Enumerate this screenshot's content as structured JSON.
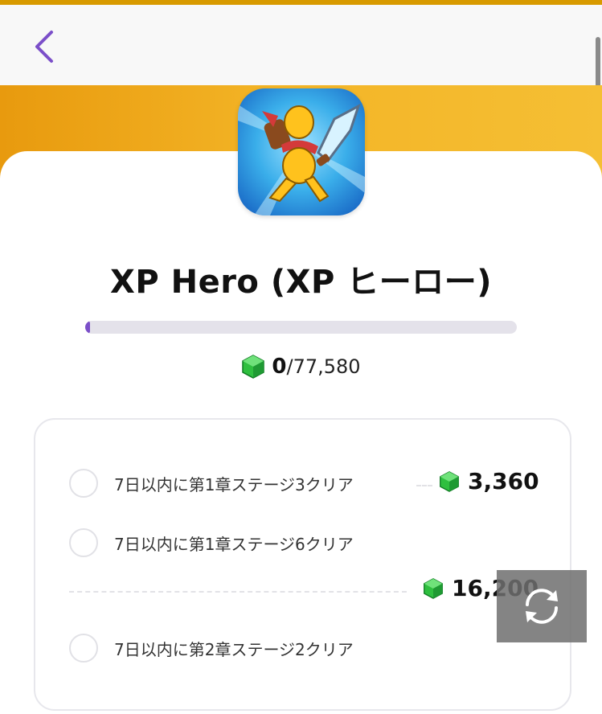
{
  "app": {
    "title": "XP Hero (XP ヒーロー)",
    "icon": "app-icon-xp-hero"
  },
  "progress": {
    "current": "0",
    "total": "/77,580",
    "fraction": 0.0
  },
  "tasks": [
    {
      "label": "7日以内に第1章ステージ3クリア",
      "reward": "3,360"
    },
    {
      "label": "7日以内に第1章ステージ6クリア",
      "reward": "16,200"
    },
    {
      "label": "7日以内に第2章ステージ2クリア"
    }
  ],
  "colors": {
    "accent": "#7b4fc9",
    "banner": "#f3b426",
    "gem": "#3ecb4a"
  },
  "icons": {
    "back": "chevron-left-icon",
    "gem": "gem-icon",
    "refresh": "refresh-icon"
  }
}
